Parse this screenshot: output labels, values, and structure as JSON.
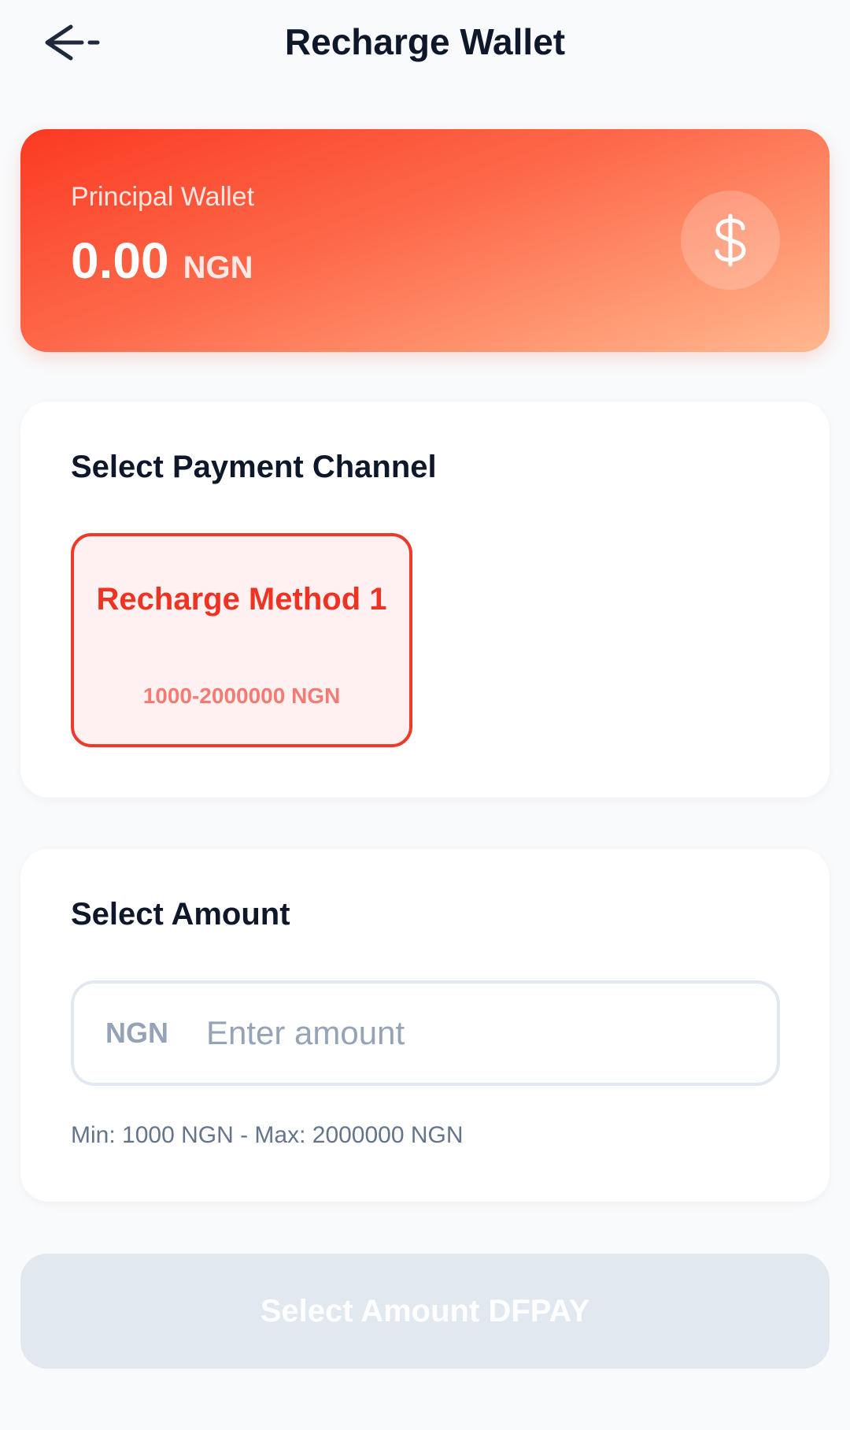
{
  "header": {
    "back_icon": "arrow-left-icon",
    "title": "Recharge Wallet"
  },
  "wallet": {
    "label": "Principal Wallet",
    "balance": "0.00",
    "currency": "NGN",
    "icon": "dollar-sign-icon"
  },
  "payment_channel": {
    "title": "Select Payment Channel",
    "methods": [
      {
        "name": "Recharge Method 1",
        "range": "1000-2000000 NGN",
        "selected": true
      }
    ]
  },
  "amount": {
    "title": "Select Amount",
    "currency": "NGN",
    "value": "",
    "placeholder": "Enter amount",
    "hint": "Min: 1000 NGN - Max: 2000000 NGN"
  },
  "submit": {
    "label": "Select Amount DFPAY",
    "enabled": false
  },
  "colors": {
    "accent": "#ee3322",
    "background": "#f8fafc",
    "disabled_button": "#e2e8f0"
  }
}
